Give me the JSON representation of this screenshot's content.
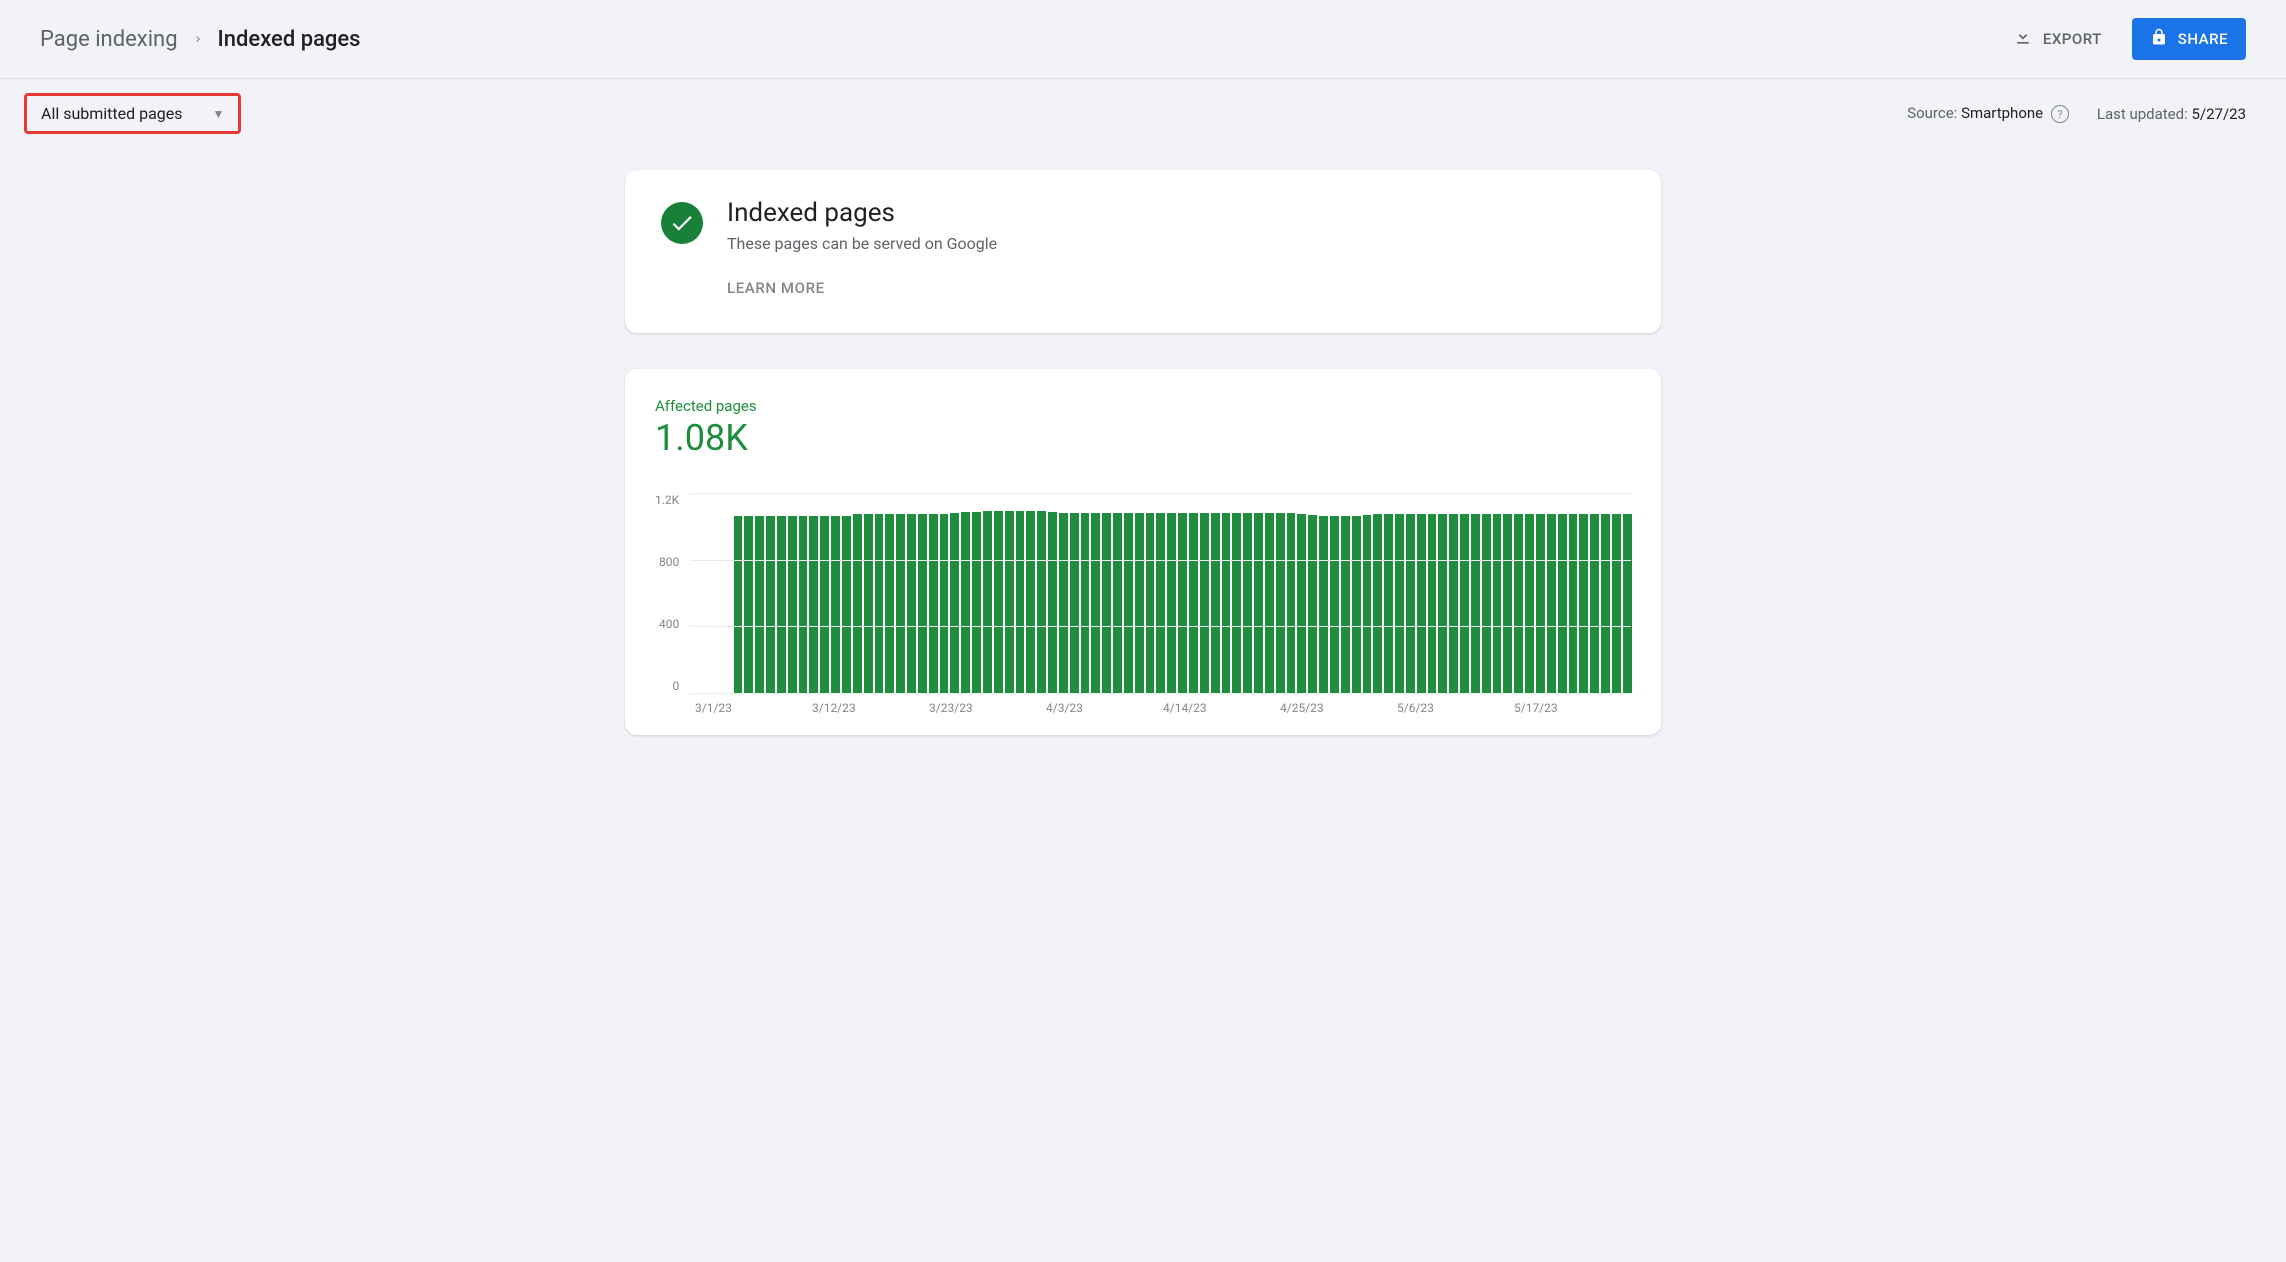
{
  "breadcrumb": {
    "root": "Page indexing",
    "current": "Indexed pages"
  },
  "actions": {
    "export": "EXPORT",
    "share": "SHARE"
  },
  "filter": {
    "label": "All submitted pages"
  },
  "source": {
    "label": "Source:",
    "value": "Smartphone"
  },
  "updated": {
    "label": "Last updated:",
    "value": "5/27/23"
  },
  "status": {
    "title": "Indexed pages",
    "subtitle": "These pages can be served on Google",
    "learn_more": "LEARN MORE"
  },
  "chart": {
    "metric_label": "Affected pages",
    "metric_value": "1.08K"
  },
  "chart_data": {
    "type": "bar",
    "ylabel": "",
    "xlabel": "",
    "ylim": [
      0,
      1200
    ],
    "y_ticks": [
      "1.2K",
      "800",
      "400",
      "0"
    ],
    "x_ticks": [
      "3/1/23",
      "3/12/23",
      "3/23/23",
      "4/3/23",
      "4/14/23",
      "4/25/23",
      "5/6/23",
      "5/17/23"
    ],
    "leading_empty_bars": 4,
    "values": [
      1060,
      1060,
      1060,
      1060,
      1060,
      1060,
      1060,
      1060,
      1060,
      1060,
      1065,
      1075,
      1075,
      1075,
      1075,
      1075,
      1075,
      1075,
      1075,
      1075,
      1080,
      1085,
      1085,
      1090,
      1090,
      1090,
      1090,
      1090,
      1090,
      1085,
      1080,
      1080,
      1080,
      1080,
      1080,
      1080,
      1080,
      1080,
      1080,
      1080,
      1080,
      1080,
      1080,
      1080,
      1080,
      1080,
      1080,
      1080,
      1080,
      1080,
      1080,
      1080,
      1075,
      1070,
      1065,
      1060,
      1060,
      1065,
      1070,
      1075,
      1075,
      1075,
      1075,
      1075,
      1075,
      1075,
      1075,
      1075,
      1075,
      1075,
      1075,
      1075,
      1075,
      1075,
      1075,
      1075,
      1075,
      1075,
      1075,
      1075,
      1075,
      1075,
      1075
    ]
  }
}
